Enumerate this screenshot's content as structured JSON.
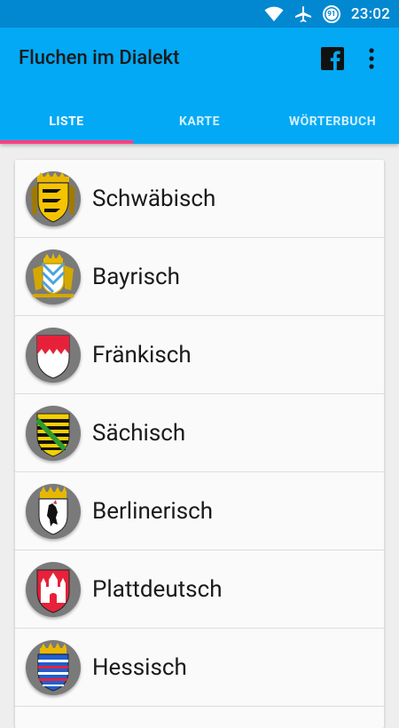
{
  "status_bar": {
    "time": "23:02",
    "battery_level": "91",
    "icons": [
      "wifi-icon",
      "airplane-icon",
      "battery-icon"
    ]
  },
  "app_bar": {
    "title": "Fluchen im Dialekt",
    "actions": [
      "facebook-icon",
      "more-vert-icon"
    ]
  },
  "tabs": [
    {
      "label": "LISTE",
      "selected": true
    },
    {
      "label": "KARTE",
      "selected": false
    },
    {
      "label": "WÖRTERBUCH",
      "selected": false
    }
  ],
  "dialects": [
    {
      "name": "Schwäbisch",
      "icon": "baden-wuerttemberg-crest-icon"
    },
    {
      "name": "Bayrisch",
      "icon": "bavaria-crest-icon"
    },
    {
      "name": "Fränkisch",
      "icon": "franconia-crest-icon"
    },
    {
      "name": "Sächisch",
      "icon": "saxony-crest-icon"
    },
    {
      "name": "Berlinerisch",
      "icon": "berlin-crest-icon"
    },
    {
      "name": "Plattdeutsch",
      "icon": "hamburg-crest-icon"
    },
    {
      "name": "Hessisch",
      "icon": "hesse-crest-icon"
    }
  ],
  "colors": {
    "status_bar": "#0288d1",
    "app_bar": "#03a9f4",
    "tab_indicator": "#ff4081",
    "background": "#eeeeee",
    "card": "#fafafa"
  }
}
